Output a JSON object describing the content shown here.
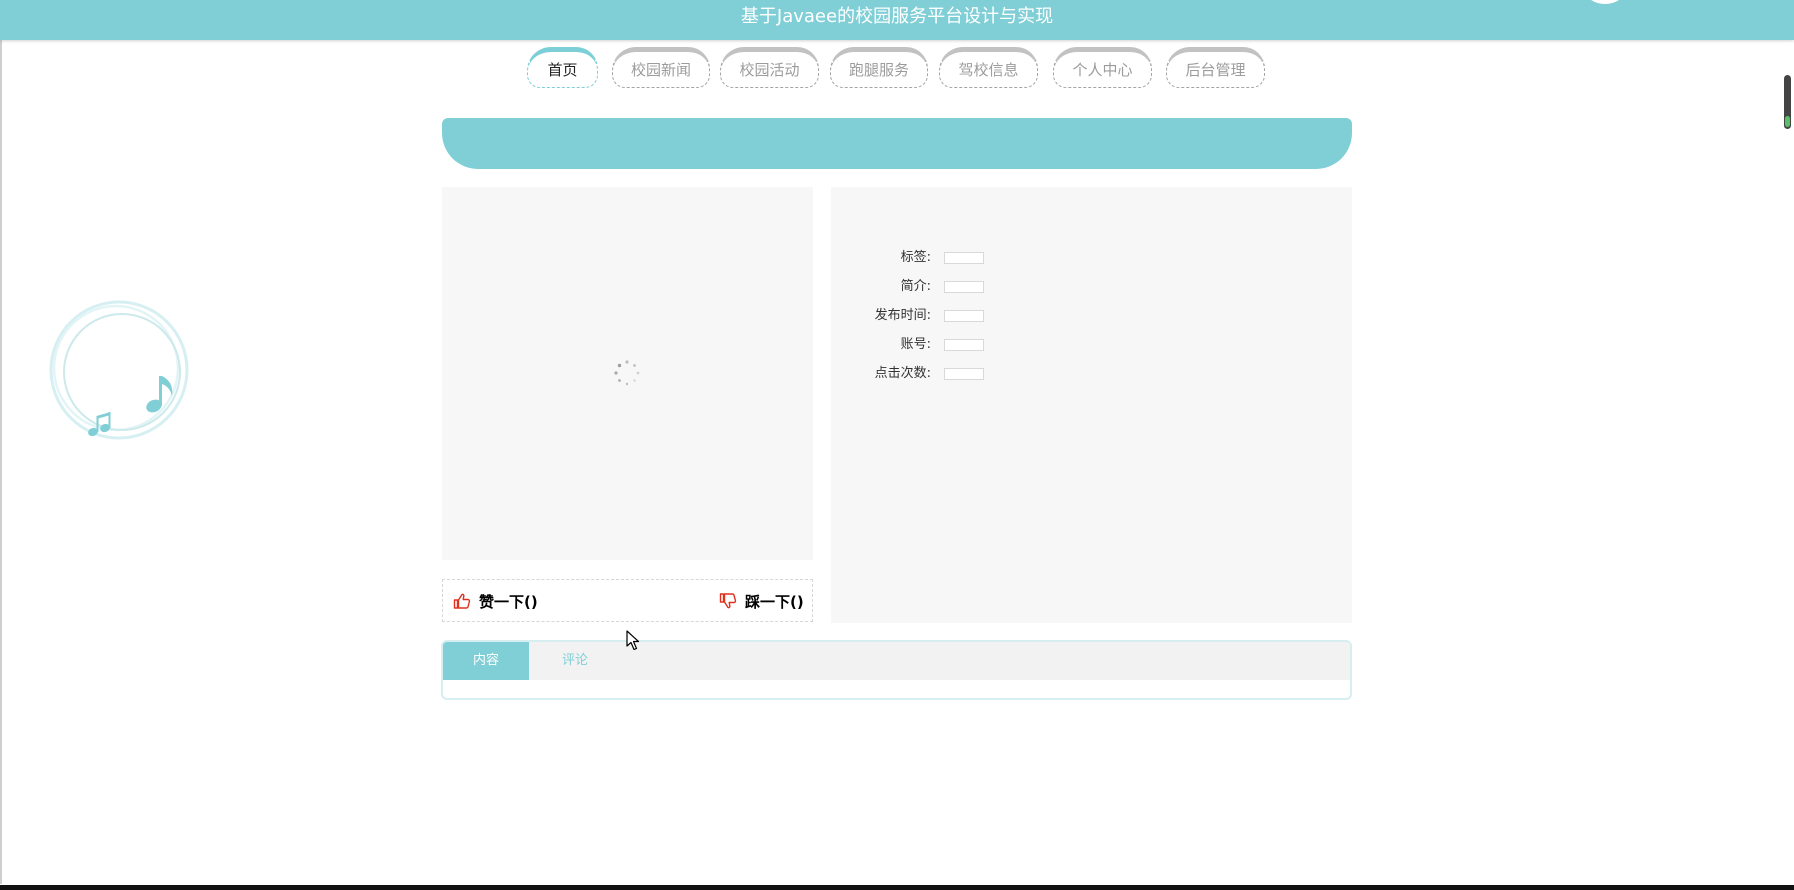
{
  "header": {
    "title": "基于Javaee的校园服务平台设计与实现"
  },
  "nav": {
    "items": [
      {
        "label": "首页",
        "active": true
      },
      {
        "label": "校园新闻",
        "active": false
      },
      {
        "label": "校园活动",
        "active": false
      },
      {
        "label": "跑腿服务",
        "active": false
      },
      {
        "label": "驾校信息",
        "active": false
      },
      {
        "label": "个人中心",
        "active": false
      },
      {
        "label": "后台管理",
        "active": false
      }
    ]
  },
  "vote": {
    "like_label": "赞一下()",
    "dislike_label": "踩一下()",
    "like_icon": "thumbs-up-icon",
    "dislike_icon": "thumbs-down-icon",
    "icon_color": "#e0301e"
  },
  "info": {
    "fields": [
      {
        "label": "标签:",
        "value": ""
      },
      {
        "label": "简介:",
        "value": ""
      },
      {
        "label": "发布时间:",
        "value": ""
      },
      {
        "label": "账号:",
        "value": ""
      },
      {
        "label": "点击次数:",
        "value": ""
      }
    ]
  },
  "tabs": {
    "items": [
      {
        "label": "内容",
        "active": true
      },
      {
        "label": "评论",
        "active": false
      }
    ]
  },
  "colors": {
    "accent": "#81cfd6",
    "panel_bg": "#f7f7f7"
  }
}
